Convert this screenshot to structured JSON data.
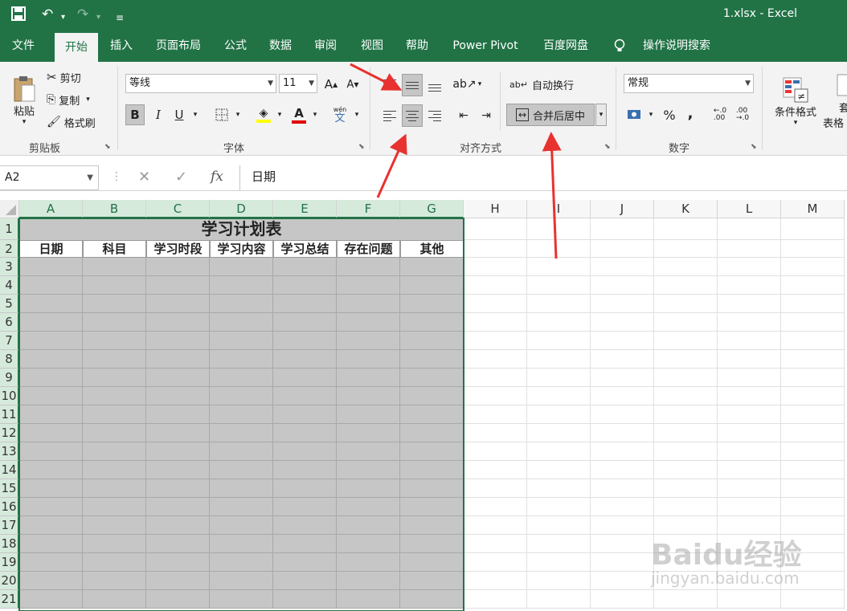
{
  "title_bar": {
    "filename": "1.xlsx",
    "separator": "-",
    "app": "Excel"
  },
  "tabs": [
    {
      "label": "文件"
    },
    {
      "label": "开始"
    },
    {
      "label": "插入"
    },
    {
      "label": "页面布局"
    },
    {
      "label": "公式"
    },
    {
      "label": "数据"
    },
    {
      "label": "审阅"
    },
    {
      "label": "视图"
    },
    {
      "label": "帮助"
    },
    {
      "label": "Power Pivot"
    },
    {
      "label": "百度网盘"
    },
    {
      "label": "操作说明搜索"
    }
  ],
  "ribbon": {
    "clipboard": {
      "paste": "粘贴",
      "cut": "剪切",
      "copy": "复制",
      "format_painter": "格式刷",
      "group": "剪贴板"
    },
    "font": {
      "name": "等线",
      "size": "11",
      "bold": "B",
      "italic": "I",
      "underline": "U",
      "group": "字体",
      "grow": "A",
      "shrink": "A",
      "color_a": "A",
      "wen": "wén",
      "wen_char": "文"
    },
    "alignment": {
      "wrap": "自动换行",
      "merge": "合并后居中",
      "group": "对齐方式"
    },
    "number": {
      "format": "常规",
      "percent": "%",
      "comma": ",",
      "group": "数字"
    },
    "styles": {
      "conditional": "条件格式",
      "table1": "套",
      "table2": "表格"
    }
  },
  "formula_bar": {
    "name_box": "A2",
    "fx": "fx",
    "content": "日期"
  },
  "columns": [
    "A",
    "B",
    "C",
    "D",
    "E",
    "F",
    "G",
    "H",
    "I",
    "J",
    "K",
    "L",
    "M"
  ],
  "rows": [
    "1",
    "2",
    "3",
    "4",
    "5",
    "6",
    "7",
    "8",
    "9",
    "10",
    "11",
    "12",
    "13",
    "14",
    "15",
    "16",
    "17",
    "18",
    "19",
    "20",
    "21"
  ],
  "sheet": {
    "title": "学习计划表",
    "headers": [
      "日期",
      "科目",
      "学习时段",
      "学习内容",
      "学习总结",
      "存在问题",
      "其他"
    ]
  },
  "watermark": {
    "brand": "Baidu经验",
    "url": "jingyan.baidu.com"
  },
  "colors": {
    "accent": "#217346",
    "selection": "#c6c6c6",
    "arrow": "#e8322f"
  }
}
